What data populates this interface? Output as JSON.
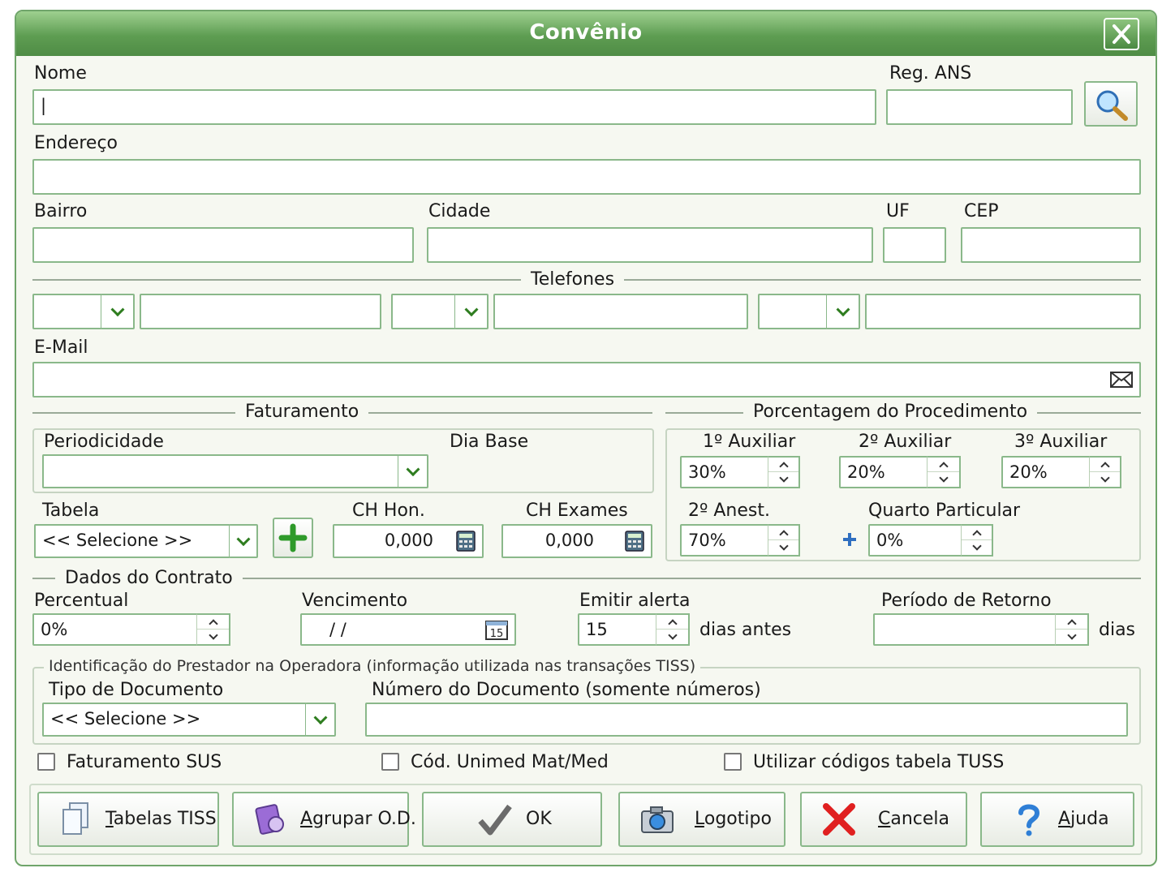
{
  "window": {
    "title": "Convênio"
  },
  "labels": {
    "nome": "Nome",
    "reg_ans": "Reg. ANS",
    "endereco": "Endereço",
    "bairro": "Bairro",
    "cidade": "Cidade",
    "uf": "UF",
    "cep": "CEP",
    "telefones": "Telefones",
    "email": "E-Mail",
    "faturamento": "Faturamento",
    "periodicidade": "Periodicidade",
    "dia_base": "Dia Base",
    "tabela": "Tabela",
    "ch_hon": "CH Hon.",
    "ch_exames": "CH Exames",
    "porcentagem": "Porcentagem do Procedimento",
    "aux1": "1º Auxiliar",
    "aux2": "2º Auxiliar",
    "aux3": "3º Auxiliar",
    "anest2": "2º Anest.",
    "quarto": "Quarto Particular",
    "dados_contrato": "Dados do Contrato",
    "percentual": "Percentual",
    "vencimento": "Vencimento",
    "emitir_alerta": "Emitir alerta",
    "dias_antes": "dias antes",
    "periodo_retorno": "Período de Retorno",
    "dias": "dias",
    "identificacao": "Identificação do Prestador na Operadora (informação utilizada nas transações TISS)",
    "tipo_documento": "Tipo de Documento",
    "numero_documento": "Número do Documento (somente números)"
  },
  "values": {
    "nome": "|",
    "tabela": "<< Selecione >>",
    "ch_hon": "0,000",
    "ch_exames": "0,000",
    "aux1": "30%",
    "aux2": "20%",
    "aux3": "20%",
    "anest2": "70%",
    "quarto": "0%",
    "percentual": "0%",
    "vencimento": "/  /",
    "emitir_alerta": "15",
    "tipo_documento": "<< Selecione >>"
  },
  "checkboxes": {
    "faturamento_sus": "Faturamento SUS",
    "cod_unimed": "Cód. Unimed Mat/Med",
    "tuss": "Utilizar códigos tabela TUSS"
  },
  "buttons": {
    "tabelas_tiss": {
      "accel": "T",
      "rest": "abelas TISS"
    },
    "agrupar": {
      "accel": "A",
      "rest": "grupar O.D."
    },
    "ok": {
      "label": "OK"
    },
    "logotipo": {
      "accel": "L",
      "rest": "ogotipo"
    },
    "cancela": {
      "accel": "C",
      "rest": "ancela"
    },
    "ajuda": {
      "accel": "A",
      "rest": "juda"
    }
  },
  "icons": {
    "close": "close-icon",
    "search": "search-icon",
    "email": "envelope-icon",
    "calculator": "calculator-icon",
    "calendar": "calendar-icon",
    "add": "plus-icon",
    "documents": "documents-icon",
    "group": "group-icon",
    "check": "checkmark-icon",
    "camera": "camera-icon",
    "cancel": "red-x-icon",
    "help": "question-icon"
  },
  "colors": {
    "title_bar": "#5e9d52",
    "accent_green": "#2e7d1f",
    "border": "#8ab88a",
    "cancel_red": "#e02020",
    "help_blue": "#2f7fd6"
  }
}
